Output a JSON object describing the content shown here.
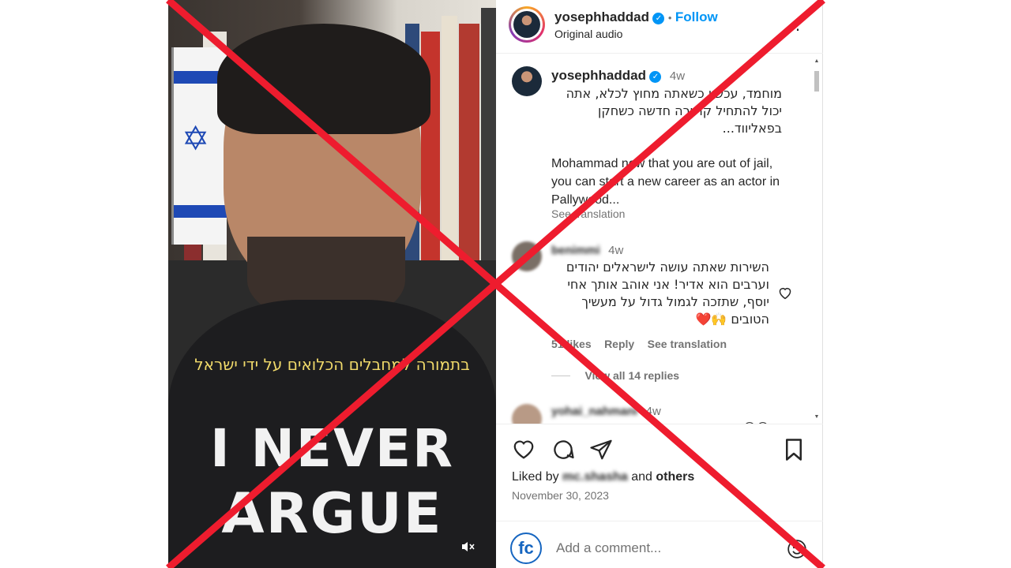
{
  "video": {
    "caption": "בתמורה למחבלים הכלואים על ידי ישראל",
    "shirt_line1": "I NEVER",
    "shirt_line2": "ARGUE"
  },
  "header": {
    "username": "yosephhaddad",
    "verified": "✓",
    "separator": "•",
    "follow_label": "Follow",
    "audio": "Original audio",
    "more": "⋮"
  },
  "post_caption": {
    "username": "yosephhaddad",
    "time": "4w",
    "hebrew": "מוחמד, עכשיו כשאתה מחוץ לכלא, אתה יכול להתחיל קריירה חדשה כשחקן בפאליווד...",
    "english": "Mohammad now that you are out of jail, you can start a new career as an actor in Pallywood...",
    "see_translation": "See translation"
  },
  "comments": [
    {
      "username": "benimmi",
      "time": "4w",
      "text": "השירות שאתה עושה לישראלים יהודים וערבים הוא אדיר! אני אוהב אותך אחי יוסף, שתזכה לגמול גדול על מעשיך הטובים 🙌❤️",
      "likes": "51 likes",
      "reply": "Reply",
      "see_translation": "See translation",
      "view_replies": "View all 14 replies"
    },
    {
      "username": "yohai_nahmani",
      "time": "4w",
      "text": "😅😅"
    }
  ],
  "footer": {
    "liked_by_prefix": "Liked by",
    "liked_by_user": "mc.shasha",
    "liked_by_suffix": "and",
    "others": "others",
    "date": "November 30, 2023",
    "fc_logo": "fc",
    "comment_placeholder": "Add a comment..."
  },
  "colors": {
    "accent": "#0095f6",
    "overlay_x": "#ee1c2e",
    "caption": "#f0d96a"
  }
}
